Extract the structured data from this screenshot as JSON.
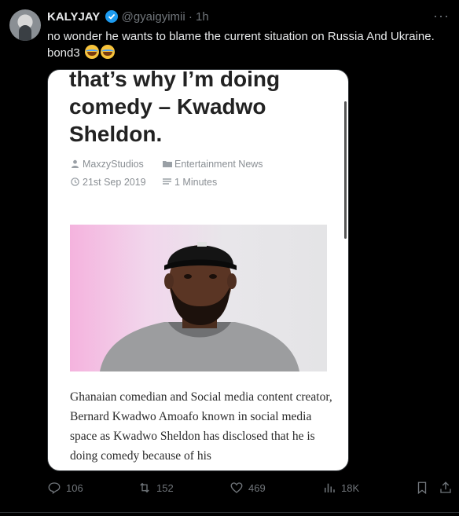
{
  "tweet": {
    "author_name": "KALYJAY",
    "handle": "@gyaigyimii",
    "separator": "·",
    "time": "1h",
    "more_label": "···",
    "text_line1": "no wonder he wants to blame the current situation on Russia And Ukraine.",
    "text_line2": "bond3"
  },
  "article": {
    "headline": "that’s why I’m doing comedy – Kwadwo Sheldon.",
    "author": "MaxzyStudios",
    "category": "Entertainment News",
    "date": "21st Sep 2019",
    "read_time": "1 Minutes",
    "body": "Ghanaian comedian and Social media content creator, Bernard Kwadwo Amoafo known in social media space as Kwadwo Sheldon has disclosed that he is doing comedy because of his"
  },
  "actions": {
    "replies": "106",
    "retweets": "152",
    "likes": "469",
    "views": "18K"
  },
  "colors": {
    "background": "#000000",
    "verified": "#1d9bf0",
    "muted": "#71767b"
  }
}
